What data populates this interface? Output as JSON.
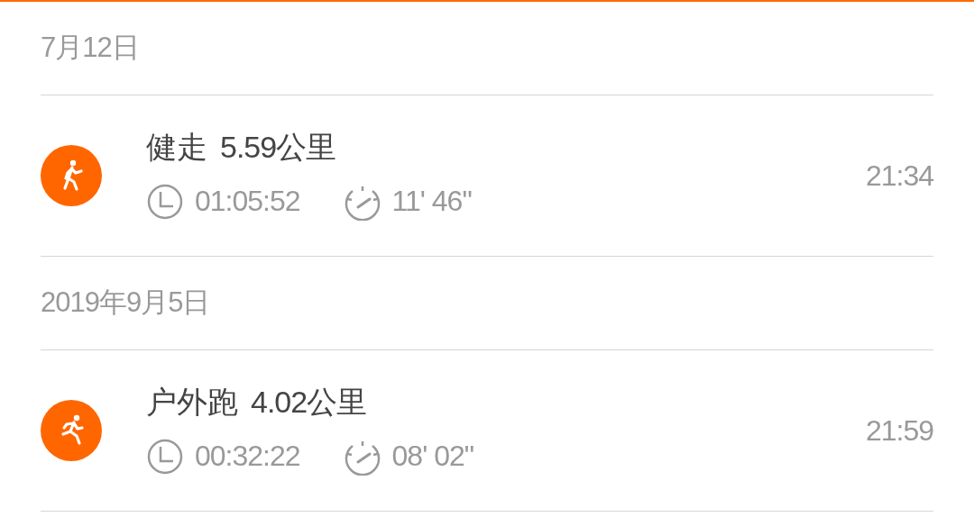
{
  "groups": [
    {
      "date": "7月12日",
      "activities": [
        {
          "kind": "walk",
          "name": "健走",
          "distance": "5.59公里",
          "duration": "01:05:52",
          "pace": "11' 46\"",
          "time": "21:34"
        }
      ]
    },
    {
      "date": "2019年9月5日",
      "activities": [
        {
          "kind": "run",
          "name": "户外跑",
          "distance": "4.02公里",
          "duration": "00:32:22",
          "pace": "08' 02\"",
          "time": "21:59"
        }
      ]
    }
  ]
}
